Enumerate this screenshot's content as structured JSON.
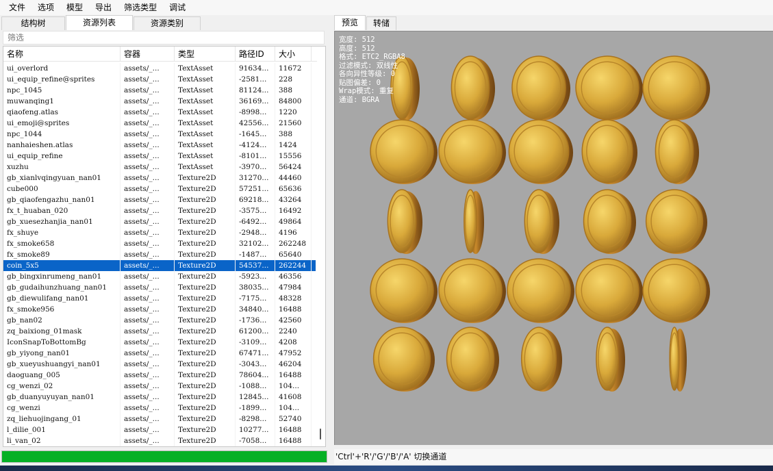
{
  "menu": [
    "文件",
    "选项",
    "模型",
    "导出",
    "筛选类型",
    "调试"
  ],
  "left_tabs": [
    {
      "label": "结构树",
      "active": false
    },
    {
      "label": "资源列表",
      "active": true
    },
    {
      "label": "资源类别",
      "active": false
    }
  ],
  "filter": {
    "placeholder": "筛选"
  },
  "table": {
    "headers": [
      "名称",
      "容器",
      "类型",
      "路径ID",
      "大小"
    ],
    "rows": [
      [
        "ui_overlord",
        "assets/_...",
        "TextAsset",
        "91634...",
        "11672"
      ],
      [
        "ui_equip_refine@sprites",
        "assets/_...",
        "TextAsset",
        "-2581...",
        "228"
      ],
      [
        "npc_1045",
        "assets/_...",
        "TextAsset",
        "81124...",
        "388"
      ],
      [
        "muwanqing1",
        "assets/_...",
        "TextAsset",
        "36169...",
        "84800"
      ],
      [
        "qiaofeng.atlas",
        "assets/_...",
        "TextAsset",
        "-8998...",
        "1220"
      ],
      [
        "ui_emoji@sprites",
        "assets/_...",
        "TextAsset",
        "42556...",
        "21560"
      ],
      [
        "npc_1044",
        "assets/_...",
        "TextAsset",
        "-1645...",
        "388"
      ],
      [
        "nanhaieshen.atlas",
        "assets/_...",
        "TextAsset",
        "-4124...",
        "1424"
      ],
      [
        "ui_equip_refine",
        "assets/_...",
        "TextAsset",
        "-8101...",
        "15556"
      ],
      [
        "xuzhu",
        "assets/_...",
        "TextAsset",
        "-3970...",
        "56424"
      ],
      [
        "gb_xianlvqingyuan_nan01",
        "assets/_...",
        "Texture2D",
        "31270...",
        "44460"
      ],
      [
        "cube000",
        "assets/_...",
        "Texture2D",
        "57251...",
        "65636"
      ],
      [
        "gb_qiaofengazhu_nan01",
        "assets/_...",
        "Texture2D",
        "69218...",
        "43264"
      ],
      [
        "fx_t_huaban_020",
        "assets/_...",
        "Texture2D",
        "-3575...",
        "16492"
      ],
      [
        "gb_xuesezhanjia_nan01",
        "assets/_...",
        "Texture2D",
        "-6492...",
        "49864"
      ],
      [
        "fx_shuye",
        "assets/_...",
        "Texture2D",
        "-2948...",
        "4196"
      ],
      [
        "fx_smoke658",
        "assets/_...",
        "Texture2D",
        "32102...",
        "262248"
      ],
      [
        "fx_smoke89",
        "assets/_...",
        "Texture2D",
        "-1487...",
        "65640"
      ],
      [
        "coin_5x5",
        "assets/_...",
        "Texture2D",
        "54537...",
        "262244"
      ],
      [
        "gb_bingxinrumeng_nan01",
        "assets/_...",
        "Texture2D",
        "-5923...",
        "46356"
      ],
      [
        "gb_gudaihunzhuang_nan01",
        "assets/_...",
        "Texture2D",
        "38035...",
        "47984"
      ],
      [
        "gb_diewulifang_nan01",
        "assets/_...",
        "Texture2D",
        "-7175...",
        "48328"
      ],
      [
        "fx_smoke956",
        "assets/_...",
        "Texture2D",
        "34840...",
        "16488"
      ],
      [
        "gb_nan02",
        "assets/_...",
        "Texture2D",
        "-1736...",
        "42560"
      ],
      [
        "zq_baixiong_01mask",
        "assets/_...",
        "Texture2D",
        "61200...",
        "2240"
      ],
      [
        "IconSnapToBottomBg",
        "assets/_...",
        "Texture2D",
        "-3109...",
        "4208"
      ],
      [
        "gb_yiyong_nan01",
        "assets/_...",
        "Texture2D",
        "67471...",
        "47952"
      ],
      [
        "gb_xueyushuangyi_nan01",
        "assets/_...",
        "Texture2D",
        "-3043...",
        "46204"
      ],
      [
        "daoguang_005",
        "assets/_...",
        "Texture2D",
        "78604...",
        "16488"
      ],
      [
        "cg_wenzi_02",
        "assets/_...",
        "Texture2D",
        "-1088...",
        "104..."
      ],
      [
        "gb_duanyuyuyan_nan01",
        "assets/_...",
        "Texture2D",
        "12845...",
        "41608"
      ],
      [
        "cg_wenzi",
        "assets/_...",
        "Texture2D",
        "-1899...",
        "104..."
      ],
      [
        "zq_liehuojingang_01",
        "assets/_...",
        "Texture2D",
        "-8298...",
        "52740"
      ],
      [
        "l_dilie_001",
        "assets/_...",
        "Texture2D",
        "10277...",
        "16488"
      ],
      [
        "li_van_02",
        "assets/_...",
        "Texture2D",
        "-7058...",
        "16488"
      ]
    ],
    "selected_index": 18
  },
  "progress": {
    "fraction": 1.0,
    "color": "#06b025"
  },
  "right_tabs": [
    {
      "label": "预览",
      "active": true
    },
    {
      "label": "转储",
      "active": false
    }
  ],
  "preview": {
    "info": {
      "width_line": "宽度: 512",
      "height_line": "高度: 512",
      "format_line": "格式: ETC2_RGBA8",
      "filter_line": "过滤模式: 双线性",
      "aniso_line": "各向异性等级: 0",
      "mip_line": "贴图偏差: 0",
      "wrap_line": "Wrap模式: 重复",
      "channel_line": "通道: BGRA"
    },
    "background": "#a7a7a7",
    "coin_rows": [
      [
        0.35,
        0.6,
        0.85,
        1.0,
        1.0
      ],
      [
        1.0,
        1.0,
        0.95,
        0.8,
        0.6
      ],
      [
        0.45,
        0.2,
        0.45,
        0.75,
        0.9
      ],
      [
        1.0,
        1.0,
        1.0,
        1.0,
        1.0
      ],
      [
        0.9,
        0.75,
        0.55,
        0.35,
        0.15
      ]
    ]
  },
  "hint": "'Ctrl'+'R'/'G'/'B'/'A' 切换通道",
  "colors": {
    "selected_row": "#0a64c8",
    "coin_gold": "#d9a93a",
    "coin_edge": "#8a5a1c"
  }
}
